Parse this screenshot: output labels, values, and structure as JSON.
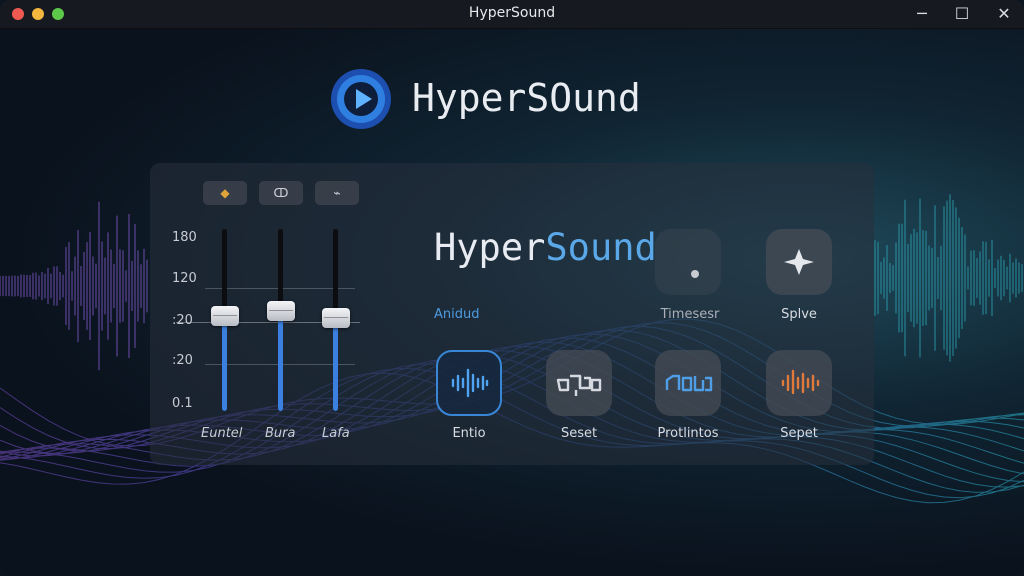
{
  "window": {
    "title": "HyperSound"
  },
  "brand": {
    "name": "HyperSOund"
  },
  "mixer": {
    "chips": [
      {
        "icon": "diamond-icon",
        "color": "#e0a23a"
      },
      {
        "icon": "loop-icon"
      },
      {
        "icon": "wave-small-icon"
      }
    ],
    "y_labels": [
      "180",
      "120",
      ":20",
      ":20",
      "0.1"
    ],
    "channels": [
      {
        "label": "Euntel",
        "level": 0.52
      },
      {
        "label": "Bura",
        "level": 0.55
      },
      {
        "label": "Lafa",
        "level": 0.51
      }
    ]
  },
  "main": {
    "title_part1": "Hyper",
    "title_part2": "Sound",
    "section_label": "Anidud",
    "top_tiles": [
      {
        "label": "Timesesr",
        "icon": "music-note-icon"
      },
      {
        "label": "Splve",
        "icon": "sparkle-icon"
      }
    ],
    "tiles": [
      {
        "label": "Entio",
        "icon": "waveform-icon",
        "active": true
      },
      {
        "label": "Seset",
        "icon": "link-icon",
        "active": false
      },
      {
        "label": "Protlintos",
        "icon": "chain-icon",
        "active": false
      },
      {
        "label": "Sepet",
        "icon": "equalizer-icon",
        "active": false
      }
    ]
  },
  "colors": {
    "accent": "#3b7fe0",
    "brand_blue": "#2f7fe0",
    "orange": "#e07a3a"
  }
}
